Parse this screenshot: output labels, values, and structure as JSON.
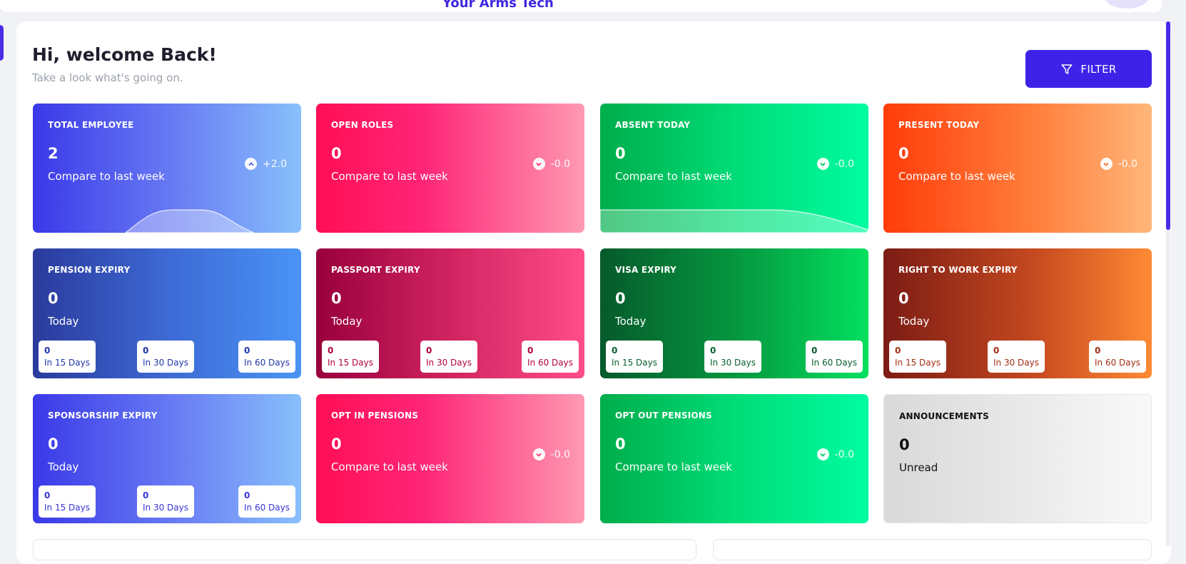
{
  "header": {
    "brand": "Your Arms Tech"
  },
  "greeting": {
    "title": "Hi, welcome Back!",
    "subtitle": "Take a look what's going on."
  },
  "filter_label": "FILTER",
  "cards": {
    "total_employee": {
      "title": "TOTAL EMPLOYEE",
      "value": "2",
      "sub": "Compare to last week",
      "delta": "+2.0",
      "trend": "up"
    },
    "open_roles": {
      "title": "OPEN ROLES",
      "value": "0",
      "sub": "Compare to last week",
      "delta": "-0.0",
      "trend": "down"
    },
    "absent_today": {
      "title": "ABSENT TODAY",
      "value": "0",
      "sub": "Compare to last week",
      "delta": "-0.0",
      "trend": "down"
    },
    "present_today": {
      "title": "PRESENT TODAY",
      "value": "0",
      "sub": "Compare to last week",
      "delta": "-0.0",
      "trend": "down"
    },
    "pension_expiry": {
      "title": "PENSION EXPIRY",
      "value": "0",
      "sub": "Today",
      "d15": "0",
      "d15_label": "In 15 Days",
      "d30": "0",
      "d30_label": "In 30 Days",
      "d60": "0",
      "d60_label": "In 60 Days"
    },
    "passport_expiry": {
      "title": "PASSPORT EXPIRY",
      "value": "0",
      "sub": "Today",
      "d15": "0",
      "d15_label": "In 15 Days",
      "d30": "0",
      "d30_label": "In 30 Days",
      "d60": "0",
      "d60_label": "In 60 Days"
    },
    "visa_expiry": {
      "title": "VISA EXPIRY",
      "value": "0",
      "sub": "Today",
      "d15": "0",
      "d15_label": "In 15 Days",
      "d30": "0",
      "d30_label": "In 30 Days",
      "d60": "0",
      "d60_label": "In 60 Days"
    },
    "right_to_work_expiry": {
      "title": "RIGHT TO WORK EXPIRY",
      "value": "0",
      "sub": "Today",
      "d15": "0",
      "d15_label": "In 15 Days",
      "d30": "0",
      "d30_label": "In 30 Days",
      "d60": "0",
      "d60_label": "In 60 Days"
    },
    "sponsorship_expiry": {
      "title": "SPONSORSHIP EXPIRY",
      "value": "0",
      "sub": "Today",
      "d15": "0",
      "d15_label": "In 15 Days",
      "d30": "0",
      "d30_label": "In 30 Days",
      "d60": "0",
      "d60_label": "In 60 Days"
    },
    "opt_in_pensions": {
      "title": "OPT IN PENSIONS",
      "value": "0",
      "sub": "Compare to last week",
      "delta": "-0.0",
      "trend": "down"
    },
    "opt_out_pensions": {
      "title": "OPT OUT PENSIONS",
      "value": "0",
      "sub": "Compare to last week",
      "delta": "-0.0",
      "trend": "down"
    },
    "announcements": {
      "title": "ANNOUNCEMENTS",
      "value": "0",
      "sub": "Unread"
    }
  },
  "icons": {
    "filter": "filter-icon",
    "up": "chevron-up-icon",
    "down": "chevron-down-icon"
  },
  "colors": {
    "accent": "#3f22e8"
  }
}
